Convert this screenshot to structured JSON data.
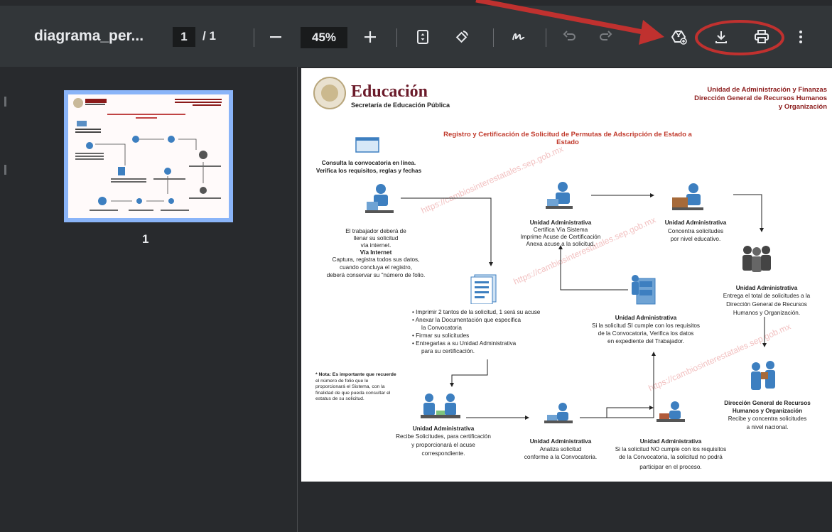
{
  "toolbar": {
    "title": "diagrama_per...",
    "page_current": "1",
    "page_sep": "/ 1",
    "zoom": "45%",
    "icons": [
      "minus-icon",
      "plus-icon",
      "fit-page-icon",
      "rotate-icon",
      "annotate-icon",
      "undo-icon",
      "redo-icon",
      "drive-save-icon",
      "download-icon",
      "print-icon",
      "more-icon"
    ]
  },
  "sidebar": {
    "thumb_number": "1"
  },
  "doc": {
    "logo_title": "Educación",
    "logo_subtitle": "Secretaría de Educación Pública",
    "header_right_1": "Unidad de Administración y Finanzas",
    "header_right_2": "Dirección General de Recursos Humanos",
    "header_right_3": "y Organización",
    "main_title_1": "Registro y Certificación de Solicitud de Permutas de Adscripción de Estado a",
    "main_title_2": "Estado",
    "consulta_1": "Consulta la convocatoria en línea.",
    "consulta_2": "Verifica los requisitos, reglas y fechas",
    "trabajador_1": "El trabajador deberá de",
    "trabajador_2": "llenar su solicitud",
    "trabajador_3": "vía internet.",
    "trabajador_4": "Vía Internet",
    "trabajador_5": "Captura, registra todos sus datos,",
    "trabajador_6": "cuando concluya el registro,",
    "trabajador_7": "deberá conservar su \"número de folio.",
    "ua1_title": "Unidad Administrativa",
    "ua1_1": "Certifica Vía Sistema",
    "ua1_2": "Imprime Acuse de Certificación",
    "ua1_3": "Anexa acuse a la solicitud.",
    "ua2_title": "Unidad Administrativa",
    "ua2_1": "Concentra solicitudes",
    "ua2_2": "por nivel educativo.",
    "ua3_title": "Unidad Administrativa",
    "ua3_1": "Entrega el total de solicitudes a la",
    "ua3_2": "Dirección General de Recursos",
    "ua3_3": "Humanos y Organización.",
    "bullets": [
      "Imprimir 2 tantos de la solicitud, 1 será su acuse",
      "Anexar la Documentación que especifica",
      "la Convocatoria",
      "Firmar su solicitudes",
      "Entregarlas a su Unidad Administrativa",
      "para su certificación."
    ],
    "ua4_title": "Unidad Administrativa",
    "ua4_1": "Si la solicitud SI cumple con los requisitos",
    "ua4_2": "de la Convocatoria, Verifica los datos",
    "ua4_3": "en expediente del Trabajador.",
    "nota_1": "* Nota: Es importante que recuerde",
    "nota_2": "el número de folio que le",
    "nota_3": "proporcionará el Sistema, con la",
    "nota_4": "finalidad de que pueda consultar el",
    "nota_5": "estatus de su solicitud.",
    "ua5_title": "Unidad Administrativa",
    "ua5_1": "Recibe Solicitudes, para certificación",
    "ua5_2": "y proporcionará el acuse",
    "ua5_3": "correspondiente.",
    "ua6_title": "Unidad Administrativa",
    "ua6_1": "Analiza solicitud",
    "ua6_2": "conforme a la Convocatoria.",
    "ua7_title": "Unidad Administrativa",
    "ua7_1": "Si la solicitud NO cumple con los requisitos",
    "ua7_2": "de la Convocatoria, la solicitud no podrá",
    "ua7_3": "participar en el proceso.",
    "dg_title_1": "Dirección General de Recursos",
    "dg_title_2": "Humanos y Organización",
    "dg_1": "Recibe y concentra solicitudes",
    "dg_2": "a nivel nacional.",
    "watermark": "https://cambiosinterestatales.sep.gob.mx"
  },
  "colors": {
    "toolbar_bg": "#323639",
    "viewer_bg": "#282a2d",
    "annotation_red": "#c0312f",
    "doc_red": "#8b1a1a",
    "thumb_border": "#8ab4f8"
  }
}
